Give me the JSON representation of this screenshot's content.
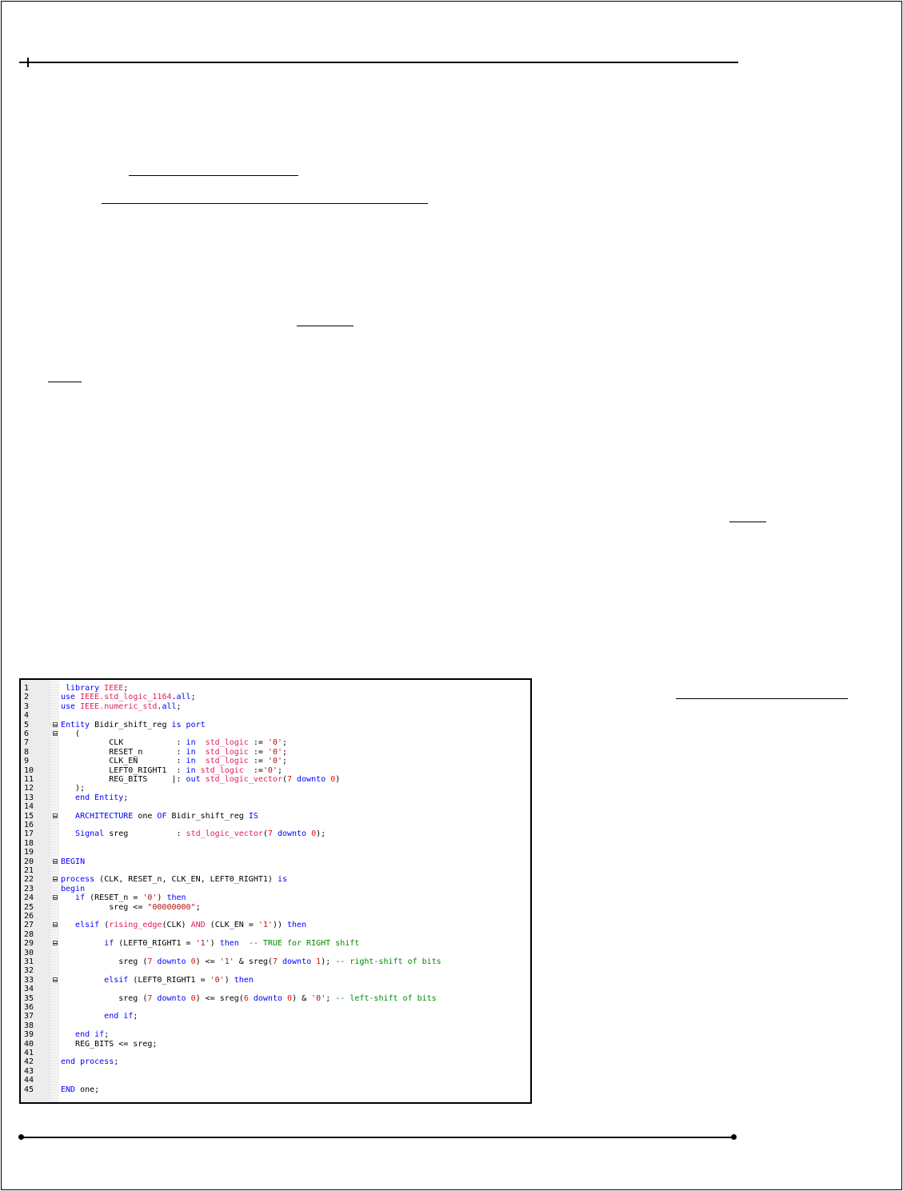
{
  "code_editor": {
    "lines": [
      {
        "n": "1",
        "fold": false,
        "indent": 1,
        "segs": [
          {
            "c": "k",
            "t": "library "
          },
          {
            "c": "t",
            "t": "IEEE"
          },
          {
            "c": "p",
            "t": ";"
          }
        ]
      },
      {
        "n": "2",
        "fold": false,
        "indent": 0,
        "segs": [
          {
            "c": "k",
            "t": "use "
          },
          {
            "c": "t",
            "t": "IEEE.std_logic_1164"
          },
          {
            "c": "p",
            "t": "."
          },
          {
            "c": "k",
            "t": "all"
          },
          {
            "c": "p",
            "t": ";"
          }
        ]
      },
      {
        "n": "3",
        "fold": false,
        "indent": 0,
        "segs": [
          {
            "c": "k",
            "t": "use "
          },
          {
            "c": "t",
            "t": "IEEE.numeric_std"
          },
          {
            "c": "p",
            "t": "."
          },
          {
            "c": "k",
            "t": "all"
          },
          {
            "c": "p",
            "t": ";"
          }
        ]
      },
      {
        "n": "4",
        "fold": false,
        "indent": 0,
        "segs": []
      },
      {
        "n": "5",
        "fold": true,
        "indent": 0,
        "segs": [
          {
            "c": "k",
            "t": "Entity "
          },
          {
            "c": "p",
            "t": "Bidir_shift_reg "
          },
          {
            "c": "k",
            "t": "is port"
          }
        ]
      },
      {
        "n": "6",
        "fold": true,
        "indent": 0,
        "segs": [
          {
            "c": "p",
            "t": "   ("
          }
        ]
      },
      {
        "n": "7",
        "fold": false,
        "indent": 0,
        "segs": [
          {
            "c": "p",
            "t": "          CLK           : "
          },
          {
            "c": "k",
            "t": "in  "
          },
          {
            "c": "t",
            "t": "std_logic "
          },
          {
            "c": "p",
            "t": ":= "
          },
          {
            "c": "s",
            "t": "'0'"
          },
          {
            "c": "p",
            "t": ";"
          }
        ]
      },
      {
        "n": "8",
        "fold": false,
        "indent": 0,
        "segs": [
          {
            "c": "p",
            "t": "          RESET_n       : "
          },
          {
            "c": "k",
            "t": "in  "
          },
          {
            "c": "t",
            "t": "std_logic "
          },
          {
            "c": "p",
            "t": ":= "
          },
          {
            "c": "s",
            "t": "'0'"
          },
          {
            "c": "p",
            "t": ";"
          }
        ]
      },
      {
        "n": "9",
        "fold": false,
        "indent": 0,
        "segs": [
          {
            "c": "p",
            "t": "          CLK_EN        : "
          },
          {
            "c": "k",
            "t": "in  "
          },
          {
            "c": "t",
            "t": "std_logic "
          },
          {
            "c": "p",
            "t": ":= "
          },
          {
            "c": "s",
            "t": "'0'"
          },
          {
            "c": "p",
            "t": ";"
          }
        ]
      },
      {
        "n": "10",
        "fold": false,
        "indent": 0,
        "segs": [
          {
            "c": "p",
            "t": "          LEFT0_RIGHT1  : "
          },
          {
            "c": "k",
            "t": "in "
          },
          {
            "c": "t",
            "t": "std_logic  "
          },
          {
            "c": "p",
            "t": ":="
          },
          {
            "c": "s",
            "t": "'0'"
          },
          {
            "c": "p",
            "t": ";"
          }
        ]
      },
      {
        "n": "11",
        "fold": false,
        "indent": 0,
        "segs": [
          {
            "c": "p",
            "t": "          REG_BITS     |: "
          },
          {
            "c": "k",
            "t": "out "
          },
          {
            "c": "t",
            "t": "std_logic_vector"
          },
          {
            "c": "p",
            "t": "("
          },
          {
            "c": "n",
            "t": "7 "
          },
          {
            "c": "k",
            "t": "downto "
          },
          {
            "c": "n",
            "t": "0"
          },
          {
            "c": "p",
            "t": ")"
          }
        ]
      },
      {
        "n": "12",
        "fold": false,
        "indent": 0,
        "segs": [
          {
            "c": "p",
            "t": "   );"
          }
        ]
      },
      {
        "n": "13",
        "fold": false,
        "indent": 0,
        "segs": [
          {
            "c": "k",
            "t": "   end Entity"
          },
          {
            "c": "p",
            "t": ";"
          }
        ]
      },
      {
        "n": "14",
        "fold": false,
        "indent": 0,
        "segs": []
      },
      {
        "n": "15",
        "fold": true,
        "indent": 0,
        "segs": [
          {
            "c": "k",
            "t": "   ARCHITECTURE "
          },
          {
            "c": "p",
            "t": "one "
          },
          {
            "c": "k",
            "t": "OF "
          },
          {
            "c": "p",
            "t": "Bidir_shift_reg "
          },
          {
            "c": "k",
            "t": "IS"
          }
        ]
      },
      {
        "n": "16",
        "fold": false,
        "indent": 0,
        "segs": []
      },
      {
        "n": "17",
        "fold": false,
        "indent": 0,
        "segs": [
          {
            "c": "k",
            "t": "   Signal "
          },
          {
            "c": "p",
            "t": "sreg          : "
          },
          {
            "c": "t",
            "t": "std_logic_vector"
          },
          {
            "c": "p",
            "t": "("
          },
          {
            "c": "n",
            "t": "7 "
          },
          {
            "c": "k",
            "t": "downto "
          },
          {
            "c": "n",
            "t": "0"
          },
          {
            "c": "p",
            "t": ");"
          }
        ]
      },
      {
        "n": "18",
        "fold": false,
        "indent": 0,
        "segs": []
      },
      {
        "n": "19",
        "fold": false,
        "indent": 0,
        "segs": []
      },
      {
        "n": "20",
        "fold": true,
        "indent": 0,
        "segs": [
          {
            "c": "k",
            "t": "BEGIN"
          }
        ]
      },
      {
        "n": "21",
        "fold": false,
        "indent": 0,
        "segs": []
      },
      {
        "n": "22",
        "fold": true,
        "indent": 0,
        "segs": [
          {
            "c": "k",
            "t": "process "
          },
          {
            "c": "p",
            "t": "(CLK, RESET_n, CLK_EN, LEFT0_RIGHT1) "
          },
          {
            "c": "k",
            "t": "is"
          }
        ]
      },
      {
        "n": "23",
        "fold": false,
        "indent": 0,
        "segs": [
          {
            "c": "k",
            "t": "begin"
          }
        ]
      },
      {
        "n": "24",
        "fold": true,
        "indent": 0,
        "segs": [
          {
            "c": "k",
            "t": "   if "
          },
          {
            "c": "p",
            "t": "(RESET_n = "
          },
          {
            "c": "s",
            "t": "'0'"
          },
          {
            "c": "p",
            "t": ") "
          },
          {
            "c": "k",
            "t": "then"
          }
        ]
      },
      {
        "n": "25",
        "fold": false,
        "indent": 0,
        "segs": [
          {
            "c": "p",
            "t": "          sreg <= "
          },
          {
            "c": "s",
            "t": "\"00000000\""
          },
          {
            "c": "p",
            "t": ";"
          }
        ]
      },
      {
        "n": "26",
        "fold": false,
        "indent": 0,
        "segs": []
      },
      {
        "n": "27",
        "fold": true,
        "indent": 0,
        "segs": [
          {
            "c": "k",
            "t": "   elsif "
          },
          {
            "c": "p",
            "t": "("
          },
          {
            "c": "t",
            "t": "rising_edge"
          },
          {
            "c": "p",
            "t": "(CLK) "
          },
          {
            "c": "t",
            "t": "AND "
          },
          {
            "c": "p",
            "t": "(CLK_EN = "
          },
          {
            "c": "s",
            "t": "'1'"
          },
          {
            "c": "p",
            "t": ")) "
          },
          {
            "c": "k",
            "t": "then"
          }
        ]
      },
      {
        "n": "28",
        "fold": false,
        "indent": 0,
        "segs": []
      },
      {
        "n": "29",
        "fold": true,
        "indent": 0,
        "segs": [
          {
            "c": "k",
            "t": "         if "
          },
          {
            "c": "p",
            "t": "(LEFT0_RIGHT1 = "
          },
          {
            "c": "s",
            "t": "'1'"
          },
          {
            "c": "p",
            "t": ") "
          },
          {
            "c": "k",
            "t": "then  "
          },
          {
            "c": "c",
            "t": "-- TRUE for RIGHT shift"
          }
        ]
      },
      {
        "n": "30",
        "fold": false,
        "indent": 0,
        "segs": []
      },
      {
        "n": "31",
        "fold": false,
        "indent": 0,
        "segs": [
          {
            "c": "p",
            "t": "            sreg ("
          },
          {
            "c": "n",
            "t": "7 "
          },
          {
            "c": "k",
            "t": "downto "
          },
          {
            "c": "n",
            "t": "0"
          },
          {
            "c": "p",
            "t": ") <= "
          },
          {
            "c": "s",
            "t": "'1'"
          },
          {
            "c": "p",
            "t": " & sreg("
          },
          {
            "c": "n",
            "t": "7 "
          },
          {
            "c": "k",
            "t": "downto "
          },
          {
            "c": "n",
            "t": "1"
          },
          {
            "c": "p",
            "t": "); "
          },
          {
            "c": "c",
            "t": "-- right-shift of bits"
          }
        ]
      },
      {
        "n": "32",
        "fold": false,
        "indent": 0,
        "segs": []
      },
      {
        "n": "33",
        "fold": true,
        "indent": 0,
        "segs": [
          {
            "c": "k",
            "t": "         elsif "
          },
          {
            "c": "p",
            "t": "(LEFT0_RIGHT1 = "
          },
          {
            "c": "s",
            "t": "'0'"
          },
          {
            "c": "p",
            "t": ") "
          },
          {
            "c": "k",
            "t": "then"
          }
        ]
      },
      {
        "n": "34",
        "fold": false,
        "indent": 0,
        "segs": []
      },
      {
        "n": "35",
        "fold": false,
        "indent": 0,
        "segs": [
          {
            "c": "p",
            "t": "            sreg ("
          },
          {
            "c": "n",
            "t": "7 "
          },
          {
            "c": "k",
            "t": "downto "
          },
          {
            "c": "n",
            "t": "0"
          },
          {
            "c": "p",
            "t": ") <= sreg("
          },
          {
            "c": "n",
            "t": "6 "
          },
          {
            "c": "k",
            "t": "downto "
          },
          {
            "c": "n",
            "t": "0"
          },
          {
            "c": "p",
            "t": ") & "
          },
          {
            "c": "s",
            "t": "'0'"
          },
          {
            "c": "p",
            "t": "; "
          },
          {
            "c": "c",
            "t": "-- left-shift of bits"
          }
        ]
      },
      {
        "n": "36",
        "fold": false,
        "indent": 0,
        "segs": []
      },
      {
        "n": "37",
        "fold": false,
        "indent": 0,
        "segs": [
          {
            "c": "k",
            "t": "         end if"
          },
          {
            "c": "p",
            "t": ";"
          }
        ]
      },
      {
        "n": "38",
        "fold": false,
        "indent": 0,
        "segs": []
      },
      {
        "n": "39",
        "fold": false,
        "indent": 0,
        "segs": [
          {
            "c": "k",
            "t": "   end if"
          },
          {
            "c": "p",
            "t": ";"
          }
        ]
      },
      {
        "n": "40",
        "fold": false,
        "indent": 0,
        "segs": [
          {
            "c": "p",
            "t": "   REG_BITS <= sreg;"
          }
        ]
      },
      {
        "n": "41",
        "fold": false,
        "indent": 0,
        "segs": []
      },
      {
        "n": "42",
        "fold": false,
        "indent": 0,
        "segs": [
          {
            "c": "k",
            "t": "end process"
          },
          {
            "c": "p",
            "t": ";"
          }
        ]
      },
      {
        "n": "43",
        "fold": false,
        "indent": 0,
        "segs": []
      },
      {
        "n": "44",
        "fold": false,
        "indent": 0,
        "segs": []
      },
      {
        "n": "45",
        "fold": false,
        "indent": 0,
        "segs": [
          {
            "c": "k",
            "t": "END "
          },
          {
            "c": "p",
            "t": "one;"
          }
        ]
      }
    ]
  },
  "colors": {
    "keyword": "#0000ff",
    "type": "#e0205a",
    "number": "#e01010",
    "string": "#b01010",
    "comment": "#008800"
  }
}
